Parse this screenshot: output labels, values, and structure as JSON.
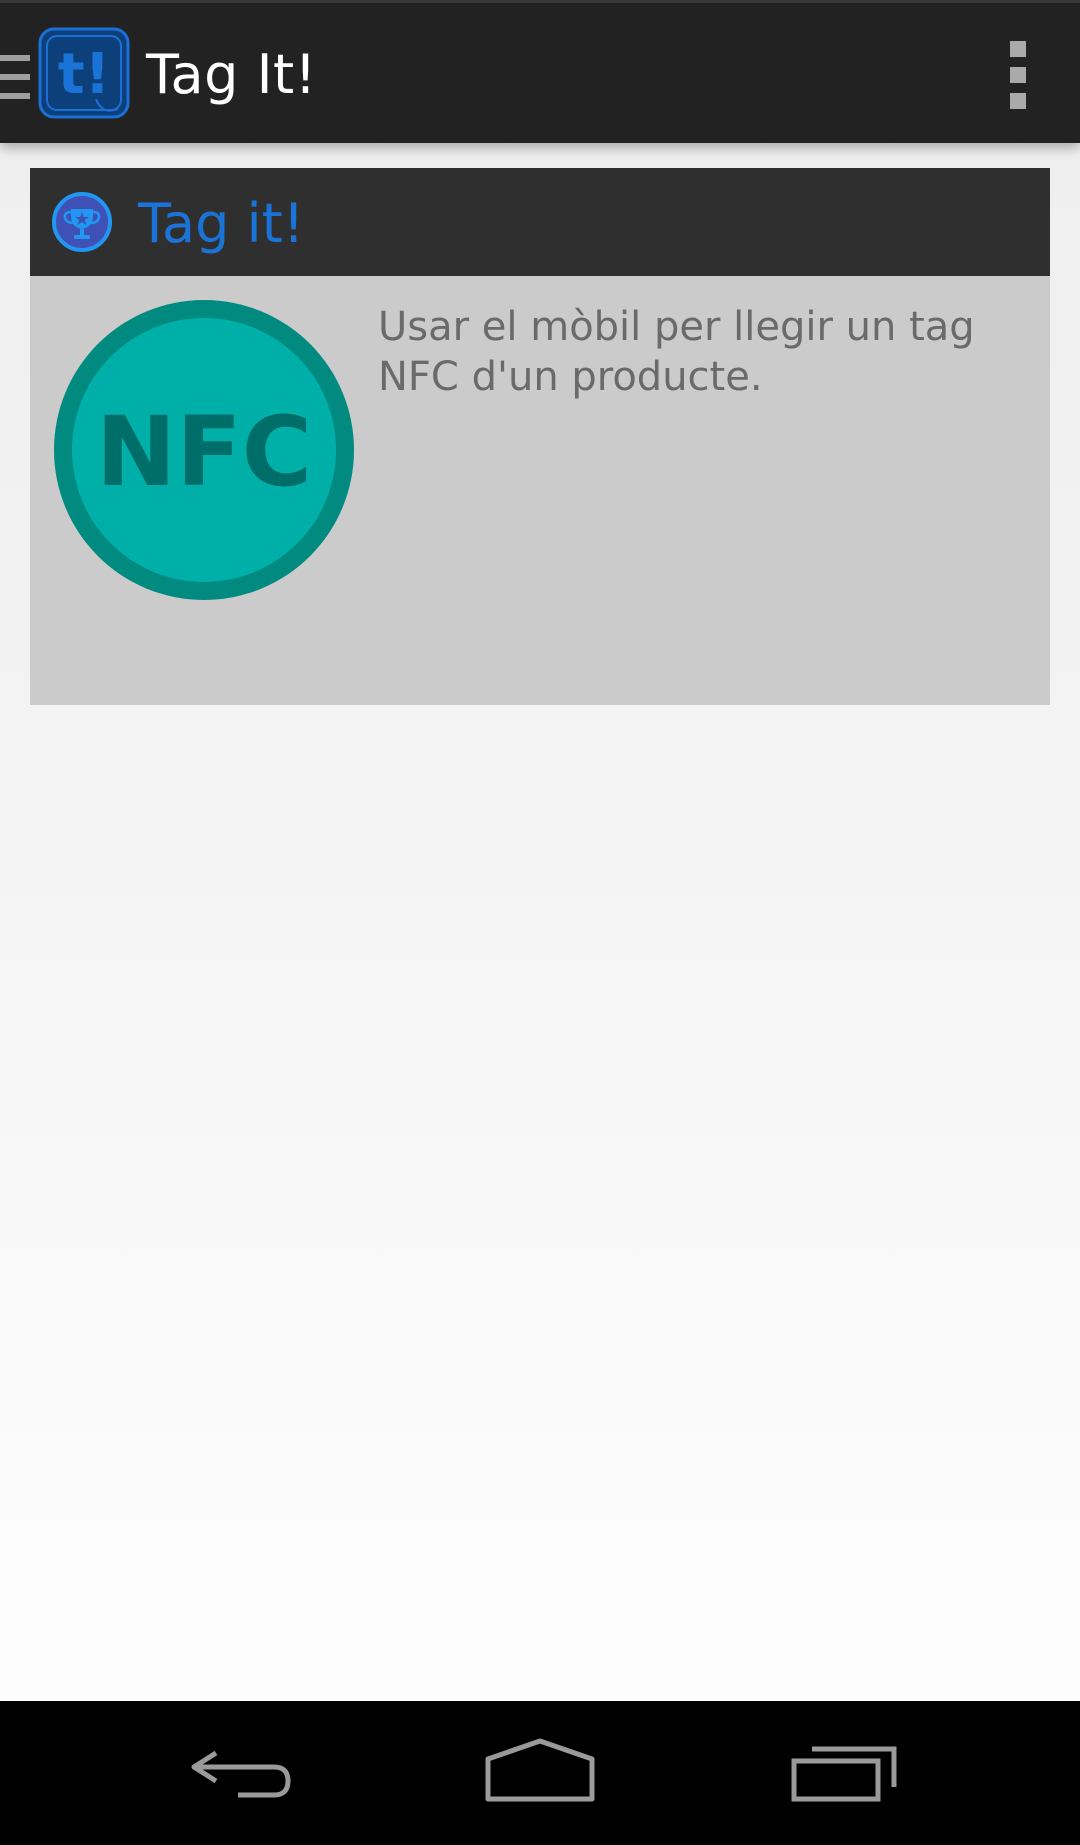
{
  "app_bar": {
    "title": "Tag It!",
    "drawer_icon": "menu-icon",
    "logo_icon": "tag-it-logo",
    "logo_text": "t!",
    "overflow_icon": "more-vert-icon"
  },
  "card": {
    "title": "Tag it!",
    "header_icon": "trophy-icon",
    "image_icon": "nfc-icon",
    "image_text": "NFC",
    "description": "Usar el mòbil per llegir un tag NFC d'un producte."
  },
  "nav_bar": {
    "back_icon": "back-icon",
    "home_icon": "home-icon",
    "recents_icon": "recents-icon"
  },
  "colors": {
    "action_bar": "#222222",
    "accent_blue": "#1a74d8",
    "card_header": "#2f2f2f",
    "card_body": "#cbcbcb",
    "nfc_fill": "#00b0a8",
    "nfc_ring": "#008a80",
    "description_text": "#6a6a6a"
  }
}
